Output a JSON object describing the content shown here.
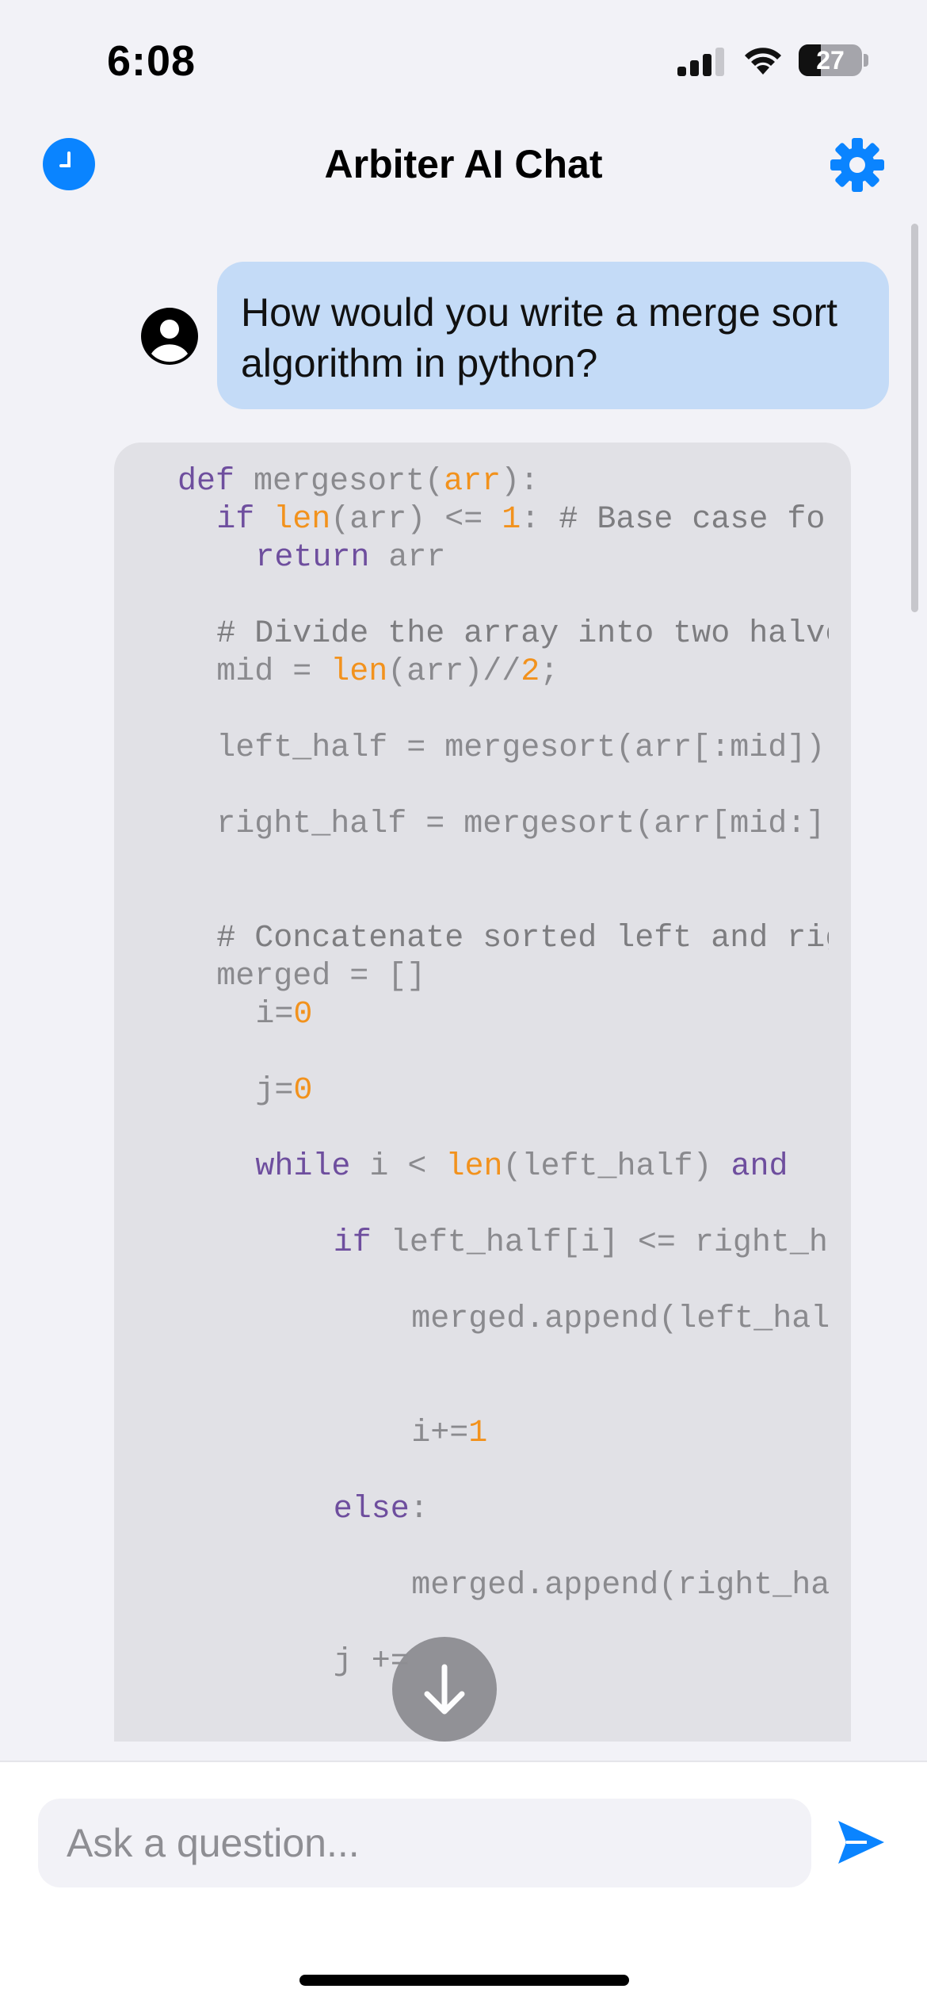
{
  "status_bar": {
    "time": "6:08",
    "battery": "27"
  },
  "header": {
    "title": "Arbiter AI Chat"
  },
  "colors": {
    "accent": "#0a84ff",
    "user_bubble": "#c4dbf7",
    "code_bg": "#e1e1e6",
    "keyword": "#6e4e9e",
    "number": "#f2921d"
  },
  "icons": {
    "history": "clock-icon",
    "settings": "gear-icon",
    "avatar": "person-circle-icon",
    "scroll_down": "arrow-down-icon",
    "send": "paper-plane-icon"
  },
  "messages": {
    "user": {
      "line1": "How would you write a merge sort",
      "line2": "algorithm in python?"
    }
  },
  "code": [
    {
      "indent": "",
      "tokens": [
        [
          "kw",
          "def"
        ],
        [
          "t",
          " mergesort("
        ],
        [
          "bi",
          "arr"
        ],
        [
          "t",
          "):"
        ]
      ]
    },
    {
      "indent": "  ",
      "tokens": [
        [
          "kw",
          "if"
        ],
        [
          "t",
          " "
        ],
        [
          "bi",
          "len"
        ],
        [
          "t",
          "(arr) <= "
        ],
        [
          "num",
          "1"
        ],
        [
          "t",
          ": "
        ],
        [
          "cm",
          "# Base case for recursion"
        ]
      ]
    },
    {
      "indent": "    ",
      "tokens": [
        [
          "kw",
          "return"
        ],
        [
          "t",
          " arr"
        ]
      ]
    },
    {
      "indent": "  ",
      "tokens": [
        [
          "cm",
          "# Divide the array into two halves"
        ]
      ]
    },
    {
      "indent": "  ",
      "tokens": [
        [
          "t",
          "mid = "
        ],
        [
          "bi",
          "len"
        ],
        [
          "t",
          "(arr)//"
        ],
        [
          "num",
          "2"
        ],
        [
          "t",
          ";"
        ]
      ]
    },
    {
      "indent": "  ",
      "tokens": [
        [
          "t",
          "left_half = mergesort(arr[:mid])"
        ]
      ]
    },
    {
      "indent": "  ",
      "tokens": [
        [
          "t",
          "right_half = mergesort(arr[mid:])"
        ]
      ]
    },
    {
      "indent": "  ",
      "tokens": [
        [
          "cm",
          "# Concatenate sorted left and right"
        ]
      ]
    },
    {
      "indent": "  ",
      "tokens": [
        [
          "t",
          "merged = []"
        ]
      ]
    },
    {
      "indent": "    ",
      "tokens": [
        [
          "t",
          "i="
        ],
        [
          "num",
          "0"
        ]
      ]
    },
    {
      "indent": "    ",
      "tokens": [
        [
          "t",
          "j="
        ],
        [
          "num",
          "0"
        ]
      ]
    },
    {
      "indent": "    ",
      "tokens": [
        [
          "kw",
          "while"
        ],
        [
          "t",
          " i < "
        ],
        [
          "bi",
          "len"
        ],
        [
          "t",
          "(left_half) "
        ],
        [
          "kw",
          "and"
        ]
      ]
    },
    {
      "indent": "        ",
      "tokens": [
        [
          "kw",
          "if"
        ],
        [
          "t",
          " left_half[i] <= right_half[j]:"
        ]
      ]
    },
    {
      "indent": "            ",
      "tokens": [
        [
          "t",
          "merged.append(left_half[i])"
        ]
      ]
    },
    {
      "indent": "            ",
      "tokens": [
        [
          "t",
          "i+="
        ],
        [
          "num",
          "1"
        ]
      ]
    },
    {
      "indent": "        ",
      "tokens": [
        [
          "kw",
          "else"
        ],
        [
          "t",
          ":"
        ]
      ]
    },
    {
      "indent": "            ",
      "tokens": [
        [
          "t",
          "merged.append(right_half[j])"
        ]
      ]
    },
    {
      "indent": "        ",
      "tokens": [
        [
          "t",
          "j +="
        ]
      ]
    }
  ],
  "input": {
    "placeholder": "Ask a question..."
  }
}
